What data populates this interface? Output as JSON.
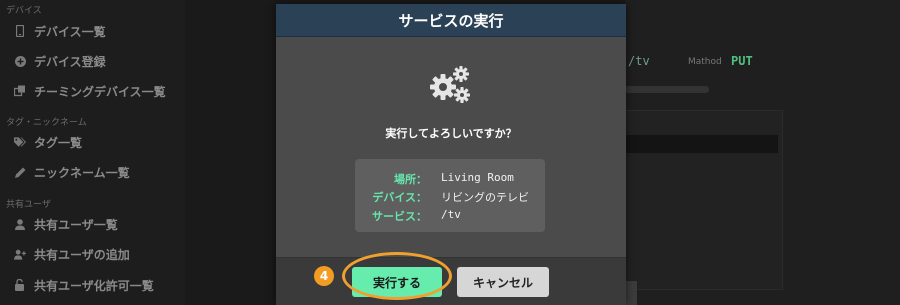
{
  "sidebar": {
    "section_device": "デバイス",
    "device_list": "デバイス一覧",
    "device_register": "デバイス登録",
    "teaming_list": "チーミングデバイス一覧",
    "section_tag": "タグ・ニックネーム",
    "tag_list": "タグ一覧",
    "nickname_list": "ニックネーム一覧",
    "section_shared": "共有ユーザ",
    "shared_user_list": "共有ユーザ一覧",
    "shared_user_add": "共有ユーザの追加",
    "shared_user_permission": "共有ユーザ化許可一覧"
  },
  "background": {
    "path": "/tv",
    "method_label": "Mathod",
    "method": "PUT"
  },
  "modal": {
    "title": "サービスの実行",
    "question": "実行してよろしいですか？",
    "info": [
      {
        "label": "場所：",
        "value": "Living Room"
      },
      {
        "label": "デバイス：",
        "value": "リビングのテレビ"
      },
      {
        "label": "サービス：",
        "value": "/tv"
      }
    ],
    "execute_label": "実行する",
    "cancel_label": "キャンセル"
  },
  "annotation": {
    "step_number": "4",
    "ring_color": "#f0a030"
  },
  "colors": {
    "accent": "#66ecad",
    "header": "#2a4156"
  }
}
